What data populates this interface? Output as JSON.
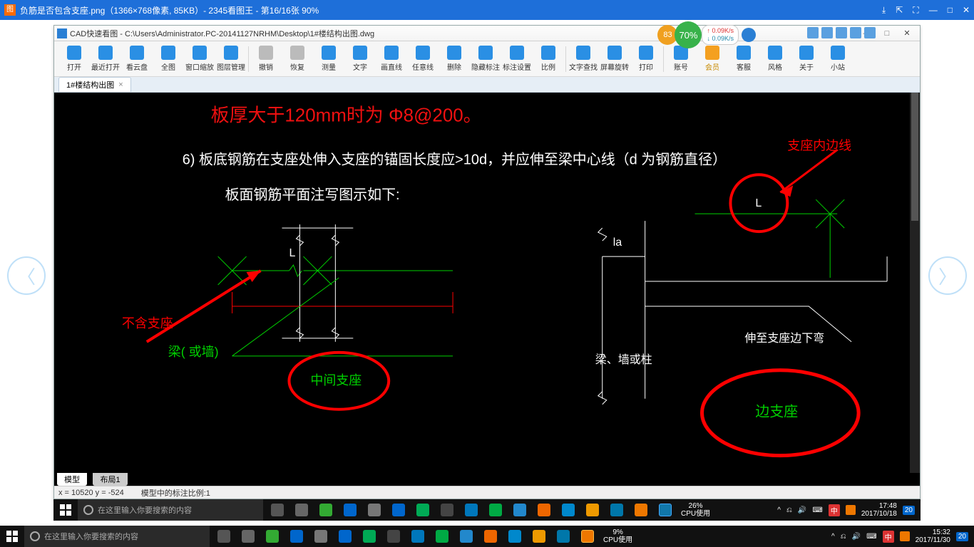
{
  "outer": {
    "title": "负筋是否包含支座.png（1366×768像素, 85KB）- 2345看图王 - 第16/16张 90%",
    "winbtns": [
      "⤓",
      "⇱",
      "⛶",
      "—",
      "□",
      "✕"
    ]
  },
  "inner": {
    "title": "CAD快速看图 - C:\\Users\\Administrator.PC-20141127NRHM\\Desktop\\1#楼结构出图.dwg",
    "tab": "1#楼结构出图",
    "min": "—",
    "max": "□",
    "close": "✕"
  },
  "speed": {
    "b1": "83",
    "b2": "70%",
    "up": "↑ 0.09K/s",
    "dn": "↓ 0.09K/s"
  },
  "toolbar": [
    {
      "lbl": "打开",
      "c": "blue"
    },
    {
      "lbl": "最近打开",
      "c": "blue"
    },
    {
      "lbl": "看云盘",
      "c": "blue"
    },
    {
      "lbl": "全图",
      "c": "blue"
    },
    {
      "lbl": "窗口缩放",
      "c": "blue"
    },
    {
      "lbl": "图层管理",
      "c": "blue"
    },
    {
      "sep": true
    },
    {
      "lbl": "撤销",
      "c": "grey"
    },
    {
      "lbl": "恢复",
      "c": "grey"
    },
    {
      "lbl": "测量",
      "c": "blue"
    },
    {
      "lbl": "文字",
      "c": "blue"
    },
    {
      "lbl": "画直线",
      "c": "blue"
    },
    {
      "lbl": "任意线",
      "c": "blue"
    },
    {
      "lbl": "删除",
      "c": "blue"
    },
    {
      "lbl": "隐藏标注",
      "c": "blue"
    },
    {
      "lbl": "标注设置",
      "c": "blue"
    },
    {
      "lbl": "比例",
      "c": "blue"
    },
    {
      "sep": true
    },
    {
      "lbl": "文字查找",
      "c": "blue"
    },
    {
      "lbl": "屏幕旋转",
      "c": "blue"
    },
    {
      "lbl": "打印",
      "c": "blue"
    },
    {
      "sep": true
    },
    {
      "lbl": "账号",
      "c": "blue"
    },
    {
      "lbl": "会员",
      "c": "orange",
      "vip": true
    },
    {
      "lbl": "客服",
      "c": "blue"
    },
    {
      "lbl": "风格",
      "c": "blue"
    },
    {
      "lbl": "关于",
      "c": "blue"
    },
    {
      "lbl": "小站",
      "c": "blue"
    }
  ],
  "canvas": {
    "title_red": "板厚大于120mm时为 Φ8@200。",
    "line6a": "6) 板底钢筋在支座处伸入支座的锚固长度应>10d，并应伸至梁中心线（d 为钢筋直径）",
    "line6b": "板面钢筋平面注写图示如下:",
    "L": "L",
    "la": "la",
    "annot_inner_edge": "支座内边线",
    "annot_no_support": "不含支座",
    "annot_beam_wall": "梁( 或墙)",
    "annot_mid_support": "中间支座",
    "annot_beam_wall_col": "梁、墙或柱",
    "annot_bend": "伸至支座边下弯",
    "annot_edge_support": "边支座"
  },
  "bottabs": {
    "model": "模型",
    "layout": "布局1"
  },
  "status": {
    "coord": "x = 10520  y = -524",
    "scale": "模型中的标注比例:1"
  },
  "taskbar_inner": {
    "search_ph": "在这里输入你要搜索的内容",
    "cpu_pct": "26%",
    "cpu_lbl": "CPU使用",
    "time": "17:48",
    "date": "2017/10/18",
    "ime": "中",
    "notif": "20"
  },
  "taskbar_outer": {
    "search_ph": "在这里输入你要搜索的内容",
    "cpu_pct": "9%",
    "cpu_lbl": "CPU使用",
    "time": "15:32",
    "date": "2017/11/30",
    "ime": "中",
    "notif": "20"
  }
}
